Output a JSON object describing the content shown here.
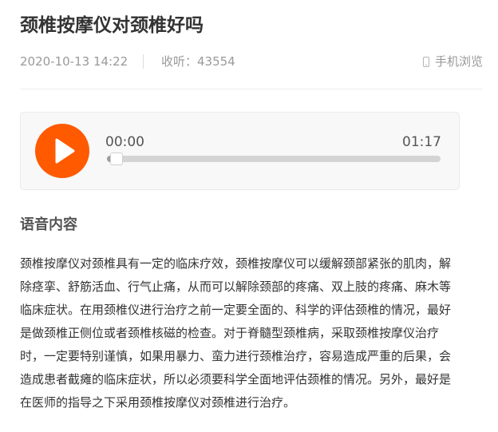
{
  "article": {
    "title": "颈椎按摩仪对颈椎好吗",
    "date": "2020-10-13 14:22",
    "listens": "收听：43554",
    "mobile_view": "手机浏览"
  },
  "player": {
    "current_time": "00:00",
    "total_time": "01:17",
    "progress": 0.02
  },
  "section": {
    "title": "语音内容"
  },
  "content": {
    "lines": [
      "颈椎按摩仪对颈椎具有一定的临床疗效，颈椎按摩仪可以缓解颈部紧张的肌肉，解",
      "除痉挛、舒筋活血、行气止痛，从而可以解除颈部的疼痛、双上肢的疼痛、麻木等",
      "临床症状。在用颈椎仪进行治疗之前一定要全面的、科学的评估颈椎的情况，最好",
      "是做颈椎正侧位或者颈椎核磁的检查。对于脊髓型颈椎病，采取颈椎按摩仪治疗",
      "时，一定要特别谨慎，如果用暴力、蛮力进行颈椎治疗，容易造成严重的后果，会",
      "造成患者截瘫的临床症状，所以必须要科学全面地评估颈椎的情况。另外，最好是",
      "在医师的指导之下采用颈椎按摩仪对颈椎进行治疗。"
    ]
  },
  "icons": {
    "play": "play-icon",
    "phone": "phone-icon"
  },
  "colors": {
    "accent": "#ff5a00",
    "title": "#333333",
    "meta": "#999999",
    "player_bg": "#f8f8f8"
  }
}
